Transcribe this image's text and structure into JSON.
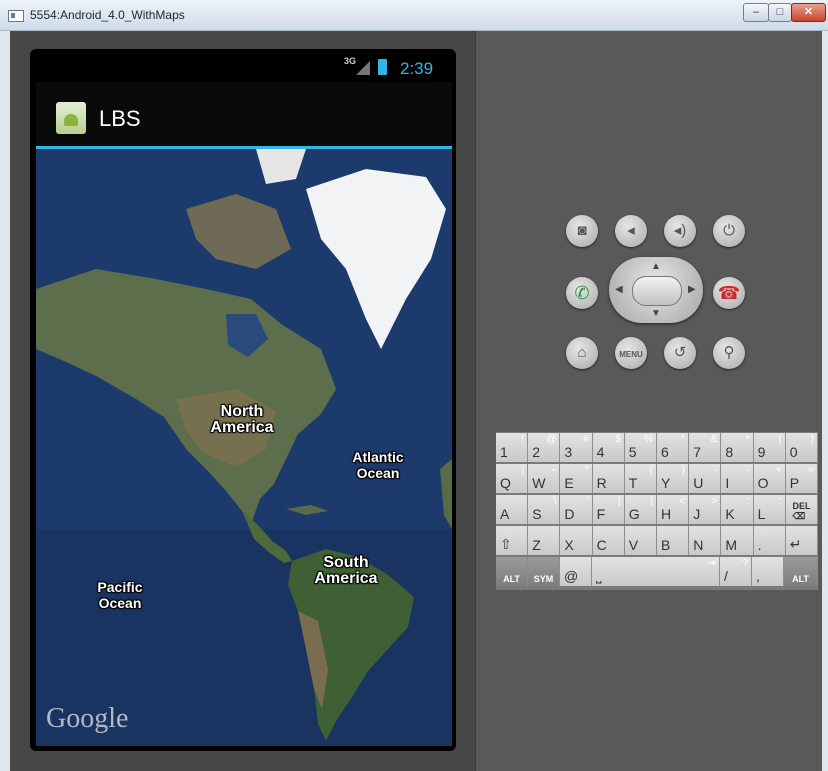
{
  "window": {
    "title": "5554:Android_4.0_WithMaps",
    "controls": {
      "minimize": "–",
      "maximize": "□",
      "close": "✕"
    }
  },
  "status_bar": {
    "network": "3G",
    "time": "2:39",
    "battery_color": "#33b5e5"
  },
  "action_bar": {
    "app_name": "LBS",
    "accent": "#33b5e5"
  },
  "map": {
    "labels": {
      "north_america": "North\nAmerica",
      "atlantic_ocean": "Atlantic\nOcean",
      "south_america": "South\nAmerica",
      "pacific_ocean": "Pacific\nOcean"
    },
    "watermark": "Google"
  },
  "device_controls": {
    "row1": [
      {
        "name": "camera-button",
        "icon": "camera-icon",
        "glyph": "◙"
      },
      {
        "name": "volume-down-button",
        "icon": "volume-down-icon",
        "glyph": "◂"
      },
      {
        "name": "volume-up-button",
        "icon": "volume-up-icon",
        "glyph": "◂)"
      },
      {
        "name": "power-button",
        "icon": "power-icon",
        "glyph": "⏻"
      }
    ],
    "call": {
      "glyph": "✆",
      "color": "#2e8b3a"
    },
    "end_call": {
      "glyph": "☎",
      "color": "#cc2a2a"
    },
    "row3": [
      {
        "name": "home-button",
        "icon": "home-icon",
        "glyph": "⌂"
      },
      {
        "name": "menu-button",
        "icon": "menu-icon",
        "glyph": "MENU"
      },
      {
        "name": "back-button",
        "icon": "back-icon",
        "glyph": "↺"
      },
      {
        "name": "search-button",
        "icon": "search-icon",
        "glyph": "⚲"
      }
    ]
  },
  "keyboard": {
    "rows": [
      [
        {
          "k": "1",
          "a": "!"
        },
        {
          "k": "2",
          "a": "@"
        },
        {
          "k": "3",
          "a": "#"
        },
        {
          "k": "4",
          "a": "$"
        },
        {
          "k": "5",
          "a": "%"
        },
        {
          "k": "6",
          "a": "^"
        },
        {
          "k": "7",
          "a": "&"
        },
        {
          "k": "8",
          "a": "*"
        },
        {
          "k": "9",
          "a": "("
        },
        {
          "k": "0",
          "a": ")"
        }
      ],
      [
        {
          "k": "Q",
          "a": "|"
        },
        {
          "k": "W",
          "a": "~"
        },
        {
          "k": "E",
          "a": "\""
        },
        {
          "k": "R",
          "a": "`"
        },
        {
          "k": "T",
          "a": "{"
        },
        {
          "k": "Y",
          "a": "}"
        },
        {
          "k": "U",
          "a": "-"
        },
        {
          "k": "I",
          "a": "-"
        },
        {
          "k": "O",
          "a": "+"
        },
        {
          "k": "P",
          "a": "="
        }
      ],
      [
        {
          "k": "A",
          "a": ""
        },
        {
          "k": "S",
          "a": "\\"
        },
        {
          "k": "D",
          "a": "'"
        },
        {
          "k": "F",
          "a": "["
        },
        {
          "k": "G",
          "a": "]"
        },
        {
          "k": "H",
          "a": "<"
        },
        {
          "k": "J",
          "a": ">"
        },
        {
          "k": "K",
          "a": ";"
        },
        {
          "k": "L",
          "a": ":"
        },
        {
          "k": "DEL ⌫",
          "a": ""
        }
      ],
      [
        {
          "k": "⇧",
          "a": ""
        },
        {
          "k": "Z",
          "a": ""
        },
        {
          "k": "X",
          "a": ""
        },
        {
          "k": "C",
          "a": ""
        },
        {
          "k": "V",
          "a": ""
        },
        {
          "k": "B",
          "a": ""
        },
        {
          "k": "N",
          "a": ""
        },
        {
          "k": "M",
          "a": ""
        },
        {
          "k": ".",
          "a": ""
        },
        {
          "k": "↵",
          "a": ""
        }
      ],
      [
        {
          "k": "ALT",
          "a": ""
        },
        {
          "k": "SYM",
          "a": ""
        },
        {
          "k": "@",
          "a": ""
        },
        {
          "k": "⎵",
          "a": "⇥"
        },
        {
          "k": "/",
          "a": "?"
        },
        {
          "k": ",",
          "a": ""
        },
        {
          "k": "ALT",
          "a": ""
        }
      ]
    ]
  }
}
